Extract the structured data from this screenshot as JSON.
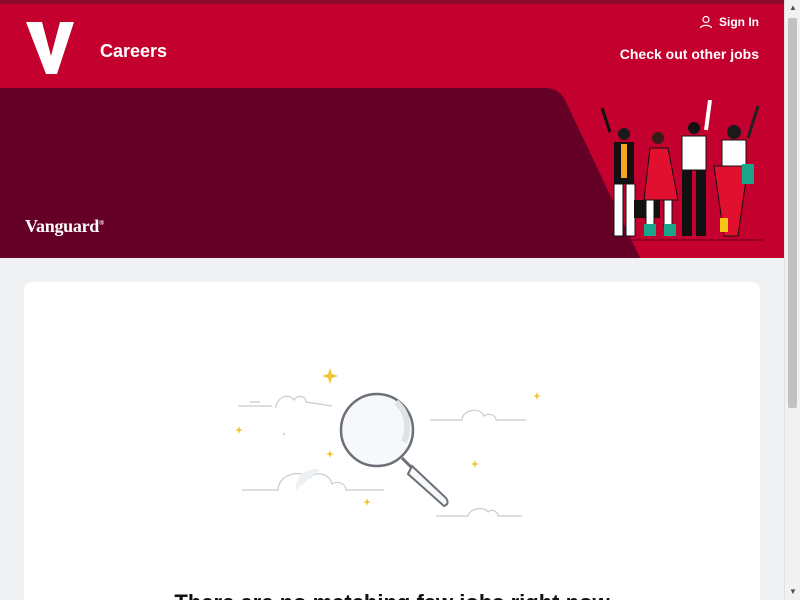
{
  "header": {
    "title": "Careers",
    "sign_in_label": "Sign In",
    "other_jobs_label": "Check out other jobs",
    "brand_color": "#c4002e"
  },
  "banner": {
    "wordmark": "Vanguard",
    "wordmark_mark": "®",
    "maroon_color": "#650026"
  },
  "main": {
    "empty_message": "There are no matching few jobs right now"
  }
}
